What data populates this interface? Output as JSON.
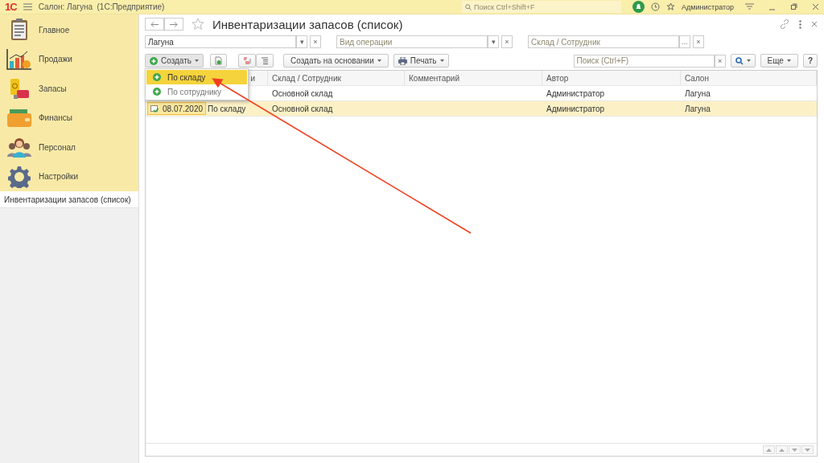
{
  "topbar": {
    "logo": "1С",
    "title": "Салон: Лагуна  (1С:Предприятие)",
    "search": {
      "placeholder": "Поиск Ctrl+Shift+F"
    },
    "user": "Администратор"
  },
  "sidebar": {
    "sections": [
      {
        "label": "Главное"
      },
      {
        "label": "Продажи"
      },
      {
        "label": "Запасы"
      },
      {
        "label": "Финансы"
      },
      {
        "label": "Персонал"
      },
      {
        "label": "Настройки"
      }
    ],
    "open_windows": [
      {
        "label": "Инвентаризации запасов (список)",
        "selected": true
      }
    ]
  },
  "form": {
    "title": "Инвентаризации запасов (список)",
    "filters": [
      {
        "value": "Лагуна",
        "button": "▾",
        "clear": "×"
      },
      {
        "placeholder": "Вид операции",
        "button": "▾",
        "clear": "×"
      },
      {
        "placeholder": "Склад / Сотрудник",
        "button": "...",
        "clear": "×"
      }
    ],
    "toolbar": {
      "create": {
        "label": "Создать",
        "expanded": true
      },
      "create_based": "Создать на основании",
      "print": "Печать",
      "search": {
        "placeholder": "Поиск (Ctrl+F)",
        "clear": "×"
      },
      "more": "Еще",
      "help": "?"
    },
    "create_menu": [
      {
        "label": "По складу",
        "selected": true
      },
      {
        "label": "По сотруднику",
        "selected": false
      }
    ],
    "table": {
      "columns": [
        {
          "label": "и",
          "partial": true
        },
        {
          "label": "Склад / Сотрудник",
          "partial": false
        },
        {
          "label": "Комментарий",
          "partial": false
        },
        {
          "label": "Автор",
          "partial": false
        },
        {
          "label": "Салон",
          "partial": false
        }
      ],
      "rows": [
        {
          "warehouse": "Основной склад",
          "author": "Администратор",
          "salon": "Лагуна",
          "selected": false
        },
        {
          "date": "08.07.2020",
          "operation": "По складу",
          "warehouse": "Основной склад",
          "author": "Администратор",
          "salon": "Лагуна",
          "selected": true
        }
      ]
    }
  }
}
